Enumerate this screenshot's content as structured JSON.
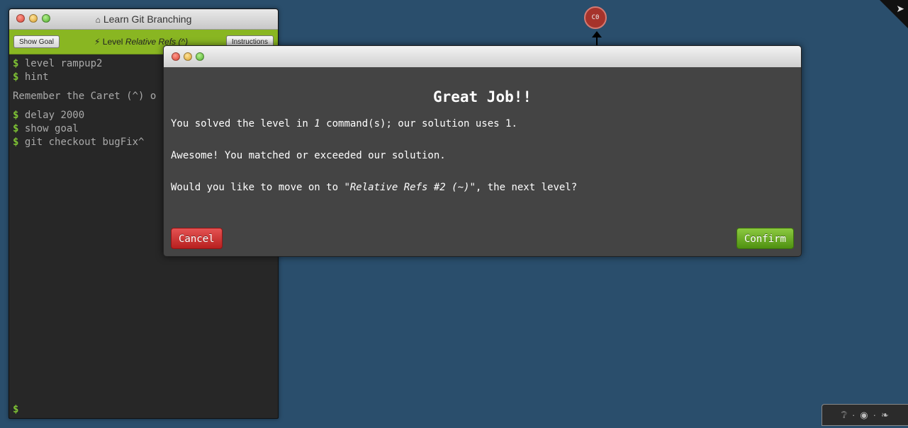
{
  "terminal": {
    "title": "Learn Git Branching",
    "show_goal_label": "Show Goal",
    "level_prefix": "Level",
    "level_name": "Relative Refs (^)",
    "instructions_label": "Instructions",
    "prompt": "$",
    "lines": [
      {
        "prefix": "$",
        "text": "level rampup2"
      },
      {
        "prefix": "$",
        "text": "hint"
      }
    ],
    "message": "Remember the Caret (^) o",
    "lines2": [
      {
        "prefix": "$",
        "text": "delay 2000"
      },
      {
        "prefix": "$",
        "text": "show goal"
      },
      {
        "prefix": "$",
        "text": "git checkout bugFix^"
      }
    ]
  },
  "graph": {
    "commit_label": "C0"
  },
  "modal": {
    "heading": "Great Job!!",
    "solved_pre": "You solved the level in ",
    "solved_count": "1",
    "solved_post": " command(s); our solution uses 1.",
    "awesome": "Awesome! You matched or exceeded our solution.",
    "next_pre": "Would you like to move on to ",
    "next_level": "\"Relative Refs #2 (~)\"",
    "next_post": ", the next level?",
    "cancel_label": "Cancel",
    "confirm_label": "Confirm"
  },
  "footer": {
    "icons": [
      "help-icon",
      "globe-icon",
      "twitter-icon"
    ],
    "separator": "·"
  },
  "colors": {
    "background": "#2a4e6c",
    "toolbar_green": "#89b622",
    "prompt_green": "#7ec234",
    "commit_red": "#a6332b",
    "cancel_red": "#c83232",
    "confirm_green": "#6aab24"
  }
}
